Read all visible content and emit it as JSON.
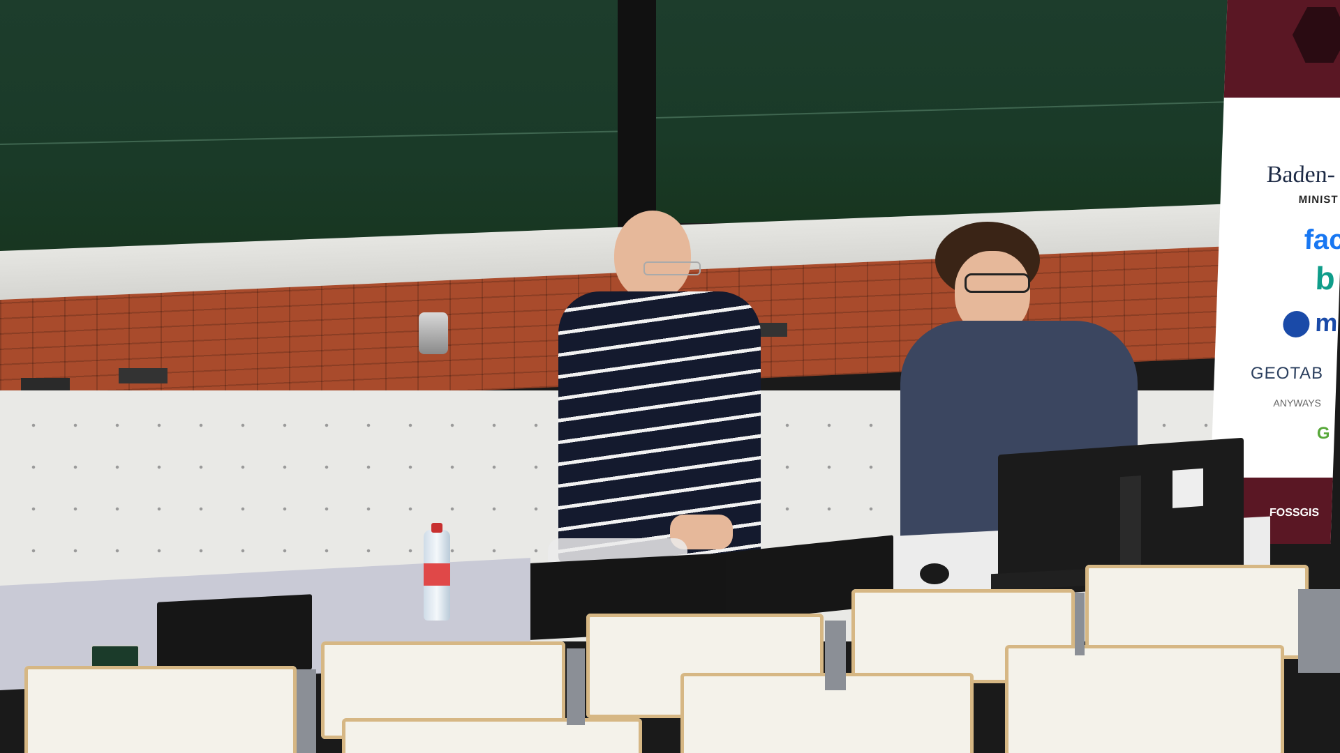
{
  "scene": {
    "description_alt": "Two presenters standing at the front desk of a lecture hall",
    "banner": {
      "line1": "Baden-",
      "line2": "MINIST",
      "logo_facebook": "fac",
      "logo_bing": "b",
      "logo_m": "m",
      "logo_geotab": "GEOTAB",
      "logo_anyways": "ANYWAYS",
      "logo_g": "G",
      "logo_fossgis": "FOSSGIS"
    }
  },
  "colors": {
    "chalkboard": "#1d3d2c",
    "banner_accent": "#5a1724",
    "brick": "#a94b2c",
    "wall": "#e9e9e6"
  }
}
